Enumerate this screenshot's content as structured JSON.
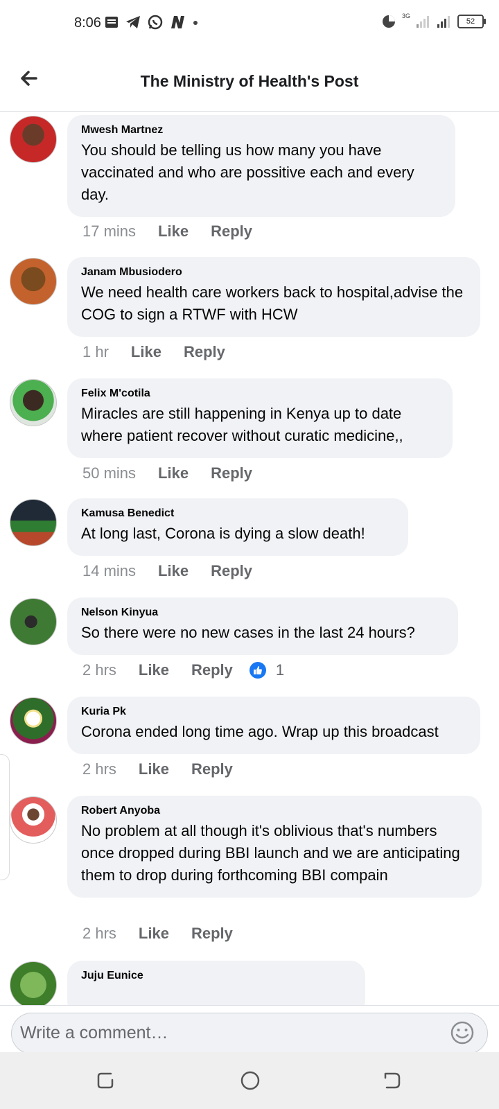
{
  "status_bar": {
    "time": "8:06",
    "network": "3G",
    "battery": "52"
  },
  "header": {
    "title": "The Ministry of Health's Post"
  },
  "comments": [
    {
      "author": "Mwesh Martnez",
      "text": "You should be telling us how many you have vaccinated and who are possitive each and every day.",
      "time": "17 mins",
      "like": "Like",
      "reply": "Reply"
    },
    {
      "author": "Janam Mbusiodero",
      "text": "We need health care workers back to hospital,advise the COG to sign a RTWF with HCW",
      "time": "1 hr",
      "like": "Like",
      "reply": "Reply"
    },
    {
      "author": "Felix M'cotila",
      "text": "Miracles are still happening in Kenya up to date where patient recover without curatic medicine,,",
      "time": "50 mins",
      "like": "Like",
      "reply": "Reply"
    },
    {
      "author": "Kamusa Benedict",
      "text": "At long last, Corona is dying a slow death!",
      "time": "14 mins",
      "like": "Like",
      "reply": "Reply"
    },
    {
      "author": "Nelson Kinyua",
      "text": "So there were no new cases in the last 24 hours?",
      "time": "2 hrs",
      "like": "Like",
      "reply": "Reply",
      "reaction_count": "1"
    },
    {
      "author": "Kuria Pk",
      "text": "Corona ended long time ago. Wrap up this broadcast",
      "time": "2 hrs",
      "like": "Like",
      "reply": "Reply"
    },
    {
      "author": "Robert Anyoba",
      "text": "No problem at all though it's oblivious that's numbers once dropped during BBI launch and we are anticipating them to drop during forthcoming BBI compain",
      "time": "2 hrs",
      "like": "Like",
      "reply": "Reply"
    },
    {
      "author": "Juju Eunice"
    }
  ],
  "composer": {
    "placeholder": "Write a comment…"
  },
  "icons": {
    "back": "arrow-left-icon",
    "reaction": "thumbs-up-icon",
    "emoji": "smiley-icon",
    "nav": [
      "recents-icon",
      "home-icon",
      "back-icon"
    ]
  },
  "colors": {
    "bubble": "#f0f2f5",
    "like_blue": "#1877f2",
    "meta_gray": "#65676b"
  }
}
